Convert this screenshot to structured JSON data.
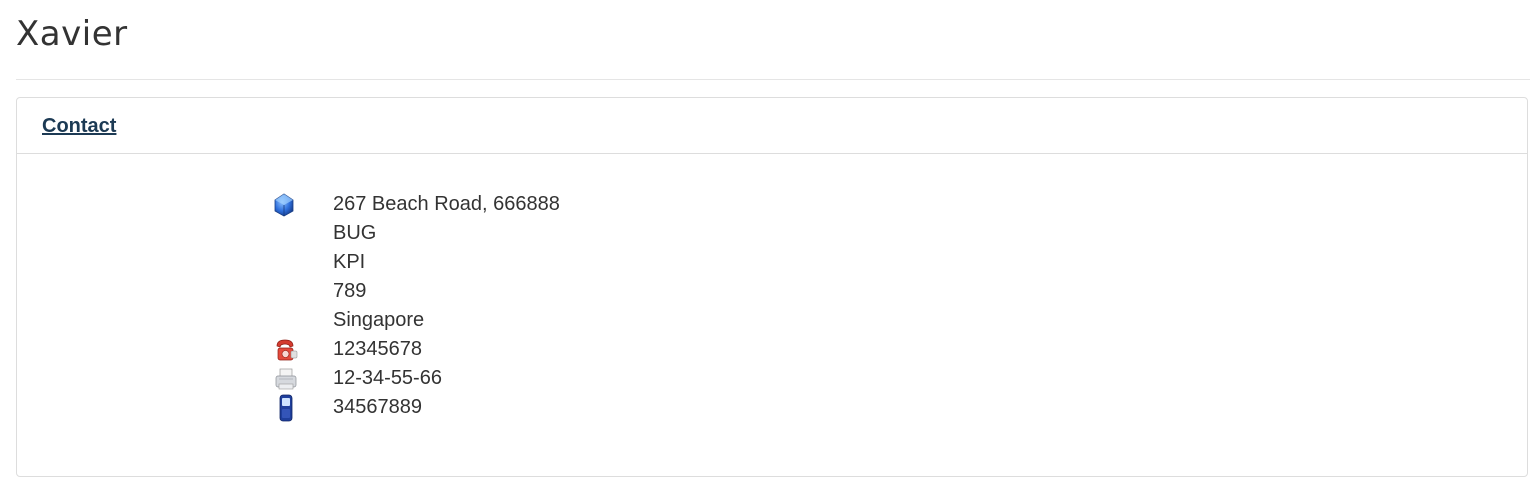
{
  "page": {
    "title": "Xavier"
  },
  "panel": {
    "heading_link": "Contact"
  },
  "contact": {
    "address_line": "267 Beach Road, 666888",
    "address_extra_1": "BUG",
    "address_extra_2": "KPI",
    "address_extra_3": "789",
    "country": "Singapore",
    "phone": "12345678",
    "fax": "12-34-55-66",
    "mobile": "34567889"
  },
  "icons": {
    "address": "address-icon",
    "phone": "phone-icon",
    "fax": "fax-icon",
    "mobile": "mobile-icon"
  },
  "colors": {
    "link": "#1c3a54",
    "text": "#333333",
    "border": "#dddddd"
  }
}
